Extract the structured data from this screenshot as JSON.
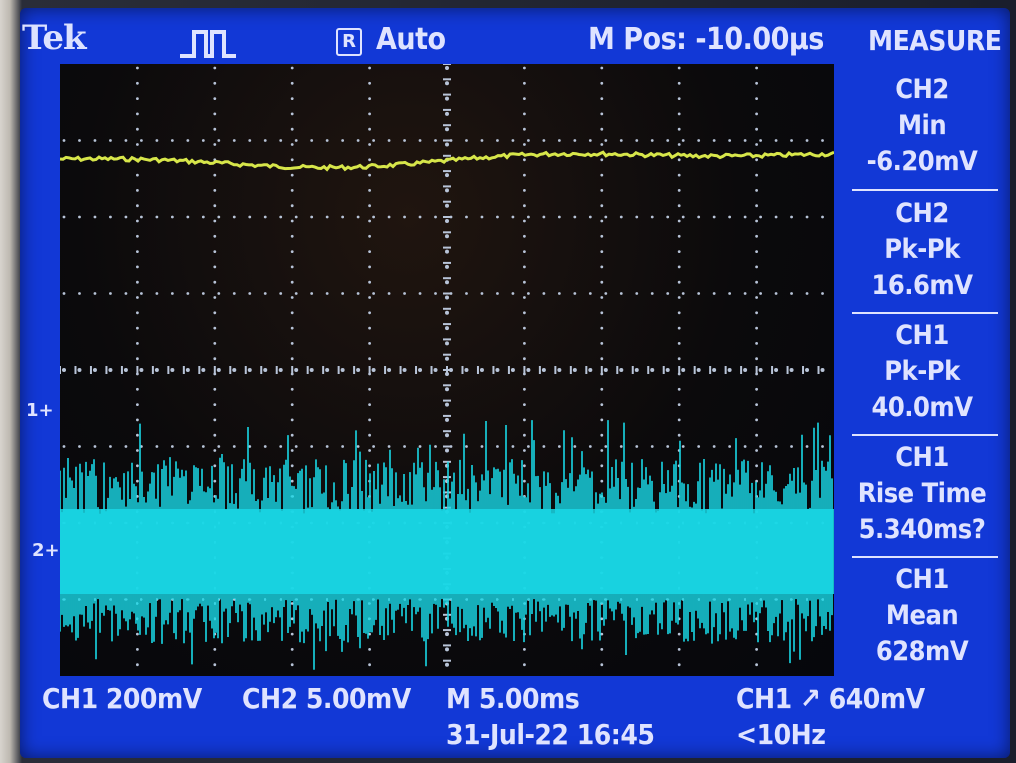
{
  "header": {
    "brand": "Tek",
    "trigger_state_box": "R",
    "trigger_mode": "Auto",
    "main_position": "M Pos: -10.00µs",
    "menu_title": "MEASURE"
  },
  "measurements": [
    {
      "channel": "CH2",
      "type": "Min",
      "value": "-6.20mV"
    },
    {
      "channel": "CH2",
      "type": "Pk-Pk",
      "value": "16.6mV"
    },
    {
      "channel": "CH1",
      "type": "Pk-Pk",
      "value": "40.0mV"
    },
    {
      "channel": "CH1",
      "type": "Rise Time",
      "value": "5.340ms?"
    },
    {
      "channel": "CH1",
      "type": "Mean",
      "value": "628mV"
    }
  ],
  "markers": {
    "ch1_ground": "1+",
    "ch2_ground": "2+"
  },
  "status": {
    "ch1_scale": "CH1  200mV",
    "ch2_scale": "CH2  5.00mV",
    "time_scale": "M 5.00ms",
    "date_time": "31-Jul-22 16:45",
    "trigger_source_level": "CH1 ↗ 640mV",
    "trigger_frequency": "<10Hz"
  },
  "colors": {
    "screen_bg": "#1238d6",
    "ch1_trace": "#19d8e6",
    "ch2_trace": "#d7e64a",
    "grid_dots": "#b8c4d8"
  },
  "icons": {
    "run": "acquire-run-icon",
    "trigger_position": "trigger-position-arrow-icon"
  }
}
